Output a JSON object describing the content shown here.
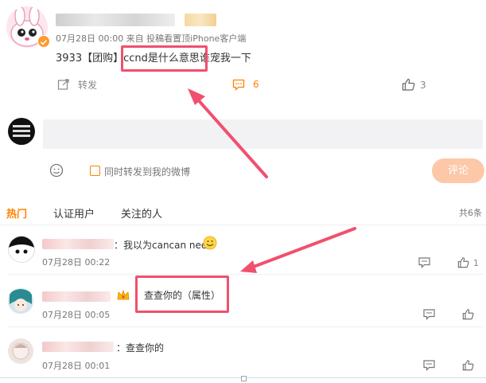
{
  "post": {
    "username_hidden": "",
    "meta": "07月28日 00:00  来自 投稿看置顶iPhone客户端",
    "content": "3933【团购】ccnd是什么意思谁宠我一下",
    "repost_label": "转发",
    "comment_count": "6",
    "like_count": "3"
  },
  "composer": {
    "placeholder": "",
    "sync_label": "同时转发到我的微博",
    "submit_label": "评论"
  },
  "tabs": {
    "hot": "热门",
    "verified": "认证用户",
    "following": "关注的人",
    "total": "共6条"
  },
  "comments": [
    {
      "text": "：我以为cancan need",
      "time": "07月28日 00:22",
      "likes": "1",
      "emoji": "smile-emoji"
    },
    {
      "text": "查查你的（属性）",
      "time": "07月28日 00:05",
      "likes": "",
      "emoji": "crown-badge"
    },
    {
      "text": "：查查你的",
      "time": "07月28日 00:01",
      "likes": "",
      "emoji": ""
    }
  ],
  "colors": {
    "accent": "#ff8200",
    "annotation": "#f0506e",
    "submit_bg": "#fcc8a8"
  }
}
